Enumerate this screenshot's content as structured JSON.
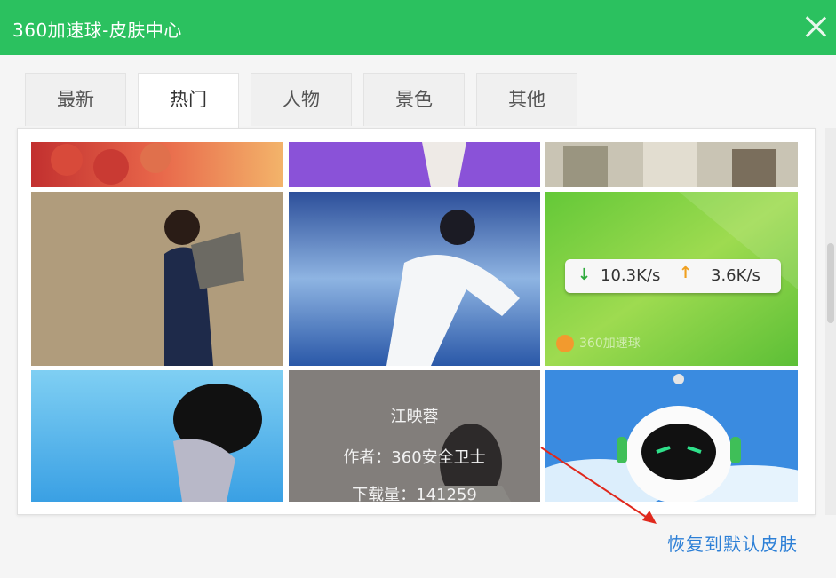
{
  "window": {
    "title": "360加速球-皮肤中心"
  },
  "tabs": [
    {
      "label": "最新",
      "active": false
    },
    {
      "label": "热门",
      "active": true
    },
    {
      "label": "人物",
      "active": false
    },
    {
      "label": "景色",
      "active": false
    },
    {
      "label": "其他",
      "active": false
    }
  ],
  "skins": {
    "hover": {
      "name": "江映蓉",
      "author": "作者：360安全卫士",
      "downloads": "下载量：141259"
    },
    "speed_preview": {
      "download": "10.3K/s",
      "upload": "3.6K/s",
      "brand": "360加速球"
    }
  },
  "footer": {
    "restore_default": "恢复到默认皮肤"
  },
  "colors": {
    "title_bar": "#2bc15f",
    "link": "#2c7fd6"
  }
}
